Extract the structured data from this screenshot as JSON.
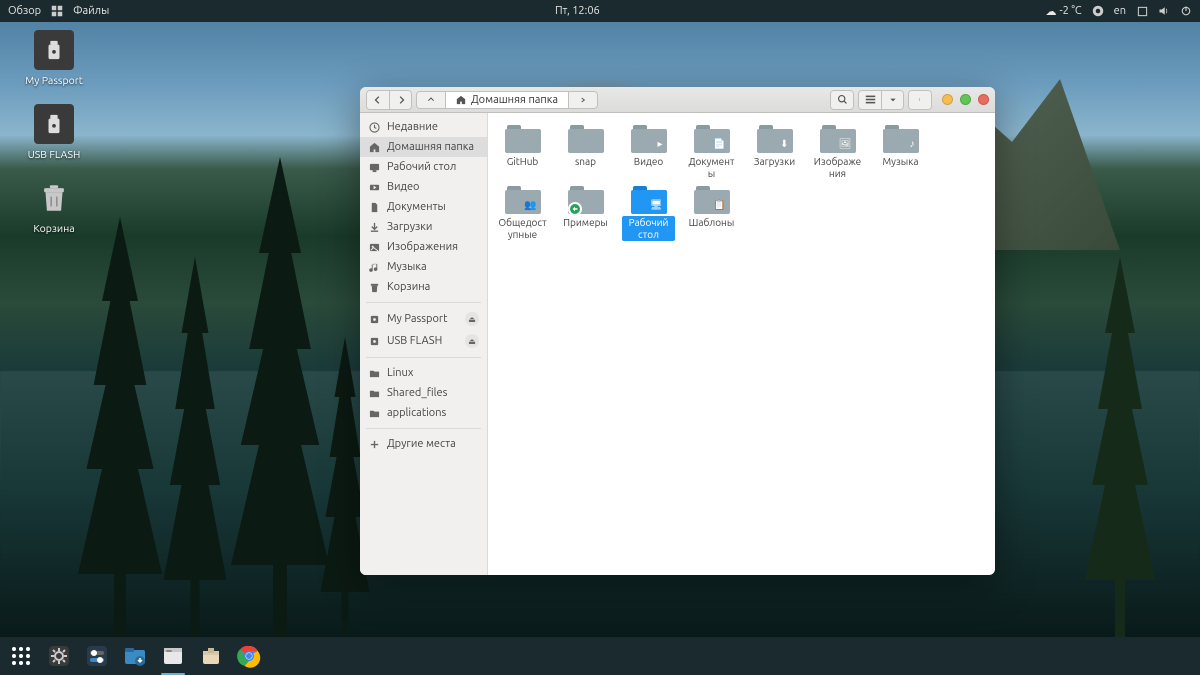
{
  "topbar": {
    "overview": "Обзор",
    "app_menu": "Файлы",
    "clock": "Пт, 12:06",
    "weather_temp": "-2 °C",
    "lang": "en"
  },
  "desktop": {
    "icons": [
      {
        "name": "My Passport",
        "kind": "usb"
      },
      {
        "name": "USB FLASH",
        "kind": "usb"
      },
      {
        "name": "Корзина",
        "kind": "trash"
      }
    ]
  },
  "dock": {
    "items": [
      {
        "name": "Приложения",
        "icon": "apps"
      },
      {
        "name": "Настройки",
        "icon": "settings"
      },
      {
        "name": "GNOME Tweaks",
        "icon": "tweaks"
      },
      {
        "name": "Downloads",
        "icon": "downloads"
      },
      {
        "name": "Файлы",
        "icon": "files",
        "running": true
      },
      {
        "name": "Software",
        "icon": "software"
      },
      {
        "name": "Google Chrome",
        "icon": "chrome"
      }
    ]
  },
  "window": {
    "toolbar": {
      "back": "Назад",
      "forward": "Вперёд",
      "search": "Поиск",
      "view": "Вид",
      "menu": "Меню"
    },
    "path": {
      "current": "Домашняя папка"
    },
    "sidebar": {
      "places": [
        {
          "label": "Недавние",
          "icon": "clock"
        },
        {
          "label": "Домашняя папка",
          "icon": "home",
          "active": true
        },
        {
          "label": "Рабочий стол",
          "icon": "desktop"
        },
        {
          "label": "Видео",
          "icon": "video"
        },
        {
          "label": "Документы",
          "icon": "documents"
        },
        {
          "label": "Загрузки",
          "icon": "downloads"
        },
        {
          "label": "Изображения",
          "icon": "images"
        },
        {
          "label": "Музыка",
          "icon": "music"
        },
        {
          "label": "Корзина",
          "icon": "trash"
        }
      ],
      "devices": [
        {
          "label": "My Passport",
          "icon": "disk",
          "eject": true
        },
        {
          "label": "USB FLASH",
          "icon": "disk",
          "eject": true
        }
      ],
      "bookmarks": [
        {
          "label": "Linux",
          "icon": "folder"
        },
        {
          "label": "Shared_files",
          "icon": "folder"
        },
        {
          "label": "applications",
          "icon": "folder"
        }
      ],
      "other": {
        "label": "Другие места",
        "icon": "plus"
      }
    },
    "items": [
      {
        "label": "GitHub",
        "emblem": null
      },
      {
        "label": "snap",
        "emblem": null
      },
      {
        "label": "Видео",
        "emblem": "video"
      },
      {
        "label": "Документы",
        "emblem": "documents"
      },
      {
        "label": "Загрузки",
        "emblem": "downloads"
      },
      {
        "label": "Изображения",
        "emblem": "images"
      },
      {
        "label": "Музыка",
        "emblem": "music"
      },
      {
        "label": "Общедоступные",
        "emblem": "public"
      },
      {
        "label": "Примеры",
        "emblem": null,
        "link": true
      },
      {
        "label": "Рабочий стол",
        "emblem": "desktop",
        "selected": true
      },
      {
        "label": "Шаблоны",
        "emblem": "templates"
      }
    ]
  }
}
